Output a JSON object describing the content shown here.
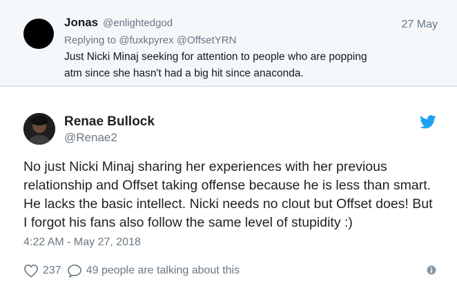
{
  "reply": {
    "name": "Jonas",
    "handle": "@enlightedgod",
    "date": "27 May",
    "replying_to": "Replying to @fuxkpyrex @OffsetYRN",
    "text": "Just Nicki Minaj seeking for attention to people who are popping atm since she hasn't had a big hit since anaconda."
  },
  "tweet": {
    "name": "Renae Bullock",
    "handle": "@Renae2",
    "text": "No just Nicki Minaj sharing her experiences with her previous relationship and Offset taking offense because he is less than smart. He lacks the basic intellect. Nicki needs no clout but Offset does! But I forgot his fans also follow the same level of stupidity :)",
    "timestamp": "4:22 AM - May 27, 2018",
    "like_count": "237",
    "talk_text": "49 people are talking about this"
  },
  "icons": {
    "bird": "twitter-bird-icon",
    "heart": "heart-icon",
    "talk": "speech-bubble-icon",
    "info": "info-icon"
  },
  "colors": {
    "twitter_blue": "#1da1f2",
    "muted": "#697882",
    "reply_bg": "#f5f8fa"
  }
}
